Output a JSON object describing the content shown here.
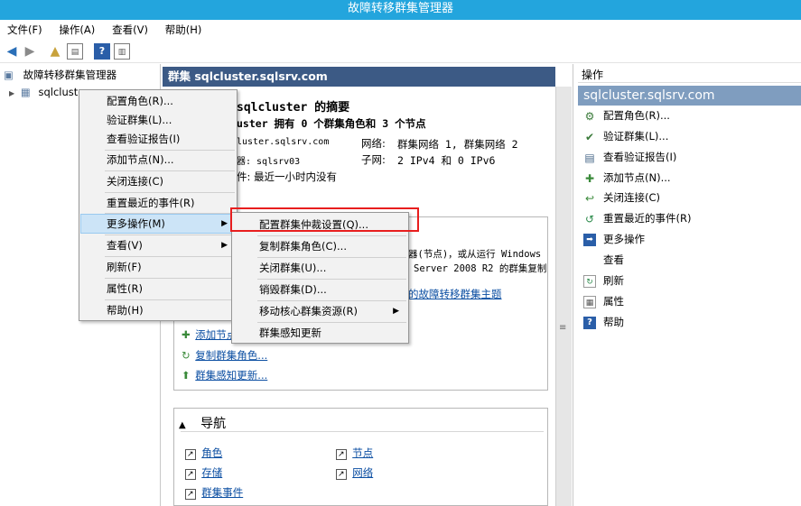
{
  "window": {
    "title": "故障转移群集管理器"
  },
  "menubar": {
    "items": [
      "文件(F)",
      "操作(A)",
      "查看(V)",
      "帮助(H)"
    ]
  },
  "tree": {
    "root": "故障转移群集管理器",
    "child": "sqlcluster"
  },
  "center": {
    "header": "群集 sqlcluster.sqlsrv.com",
    "summary_title": "sqlcluster 的摘要",
    "summary_line": "uster 拥有 0 个群集角色和 3 个节点",
    "name_value": "luster.sqlsrv.com",
    "network_label": "网络:",
    "network_value": "群集网络 1, 群集网络 2",
    "host_value": "器: sqlsrv03",
    "subnet_label": "子网:",
    "subnet_value": "2 IPv4 和 0 IPv6",
    "events_value": "件: 最近一小时内没有",
    "config_line1": "器(节点)，或从运行 Windows",
    "config_line2": "Server 2008 R2 的群集复制",
    "config_link": "的故障转移群集主题",
    "actions_links": [
      "添加节点",
      "复制群集角色...",
      "群集感知更新..."
    ],
    "nav_title": "导航",
    "nav_links": [
      "角色",
      "节点",
      "存储",
      "网络",
      "群集事件"
    ]
  },
  "actions": {
    "title": "操作",
    "subtitle": "sqlcluster.sqlsrv.com",
    "items": [
      {
        "label": "配置角色(R)...",
        "icon": "configure-role-icon"
      },
      {
        "label": "验证群集(L)...",
        "icon": "validate-icon"
      },
      {
        "label": "查看验证报告(I)",
        "icon": "report-icon"
      },
      {
        "label": "添加节点(N)...",
        "icon": "add-node-icon"
      },
      {
        "label": "关闭连接(C)",
        "icon": "close-connection-icon"
      },
      {
        "label": "重置最近的事件(R)",
        "icon": "reset-icon"
      },
      {
        "label": "更多操作",
        "icon": "more-icon"
      },
      {
        "label": "查看",
        "icon": ""
      },
      {
        "label": "刷新",
        "icon": "refresh-icon"
      },
      {
        "label": "属性",
        "icon": "properties-icon"
      },
      {
        "label": "帮助",
        "icon": "help-icon"
      }
    ]
  },
  "context_menu": {
    "items": [
      "配置角色(R)...",
      "验证群集(L)...",
      "查看验证报告(I)",
      "添加节点(N)...",
      "关闭连接(C)",
      "重置最近的事件(R)",
      "更多操作(M)",
      "查看(V)",
      "刷新(F)",
      "属性(R)",
      "帮助(H)"
    ]
  },
  "submenu": {
    "items": [
      "配置群集仲裁设置(Q)...",
      "复制群集角色(C)...",
      "关闭群集(U)...",
      "销毁群集(D)...",
      "移动核心群集资源(R)",
      "群集感知更新"
    ]
  },
  "colors": {
    "titlebar": "#23a5dd",
    "center_header": "#3c5a85",
    "actions_sub": "#7f9dbf",
    "highlight_box": "#e81e1e"
  }
}
